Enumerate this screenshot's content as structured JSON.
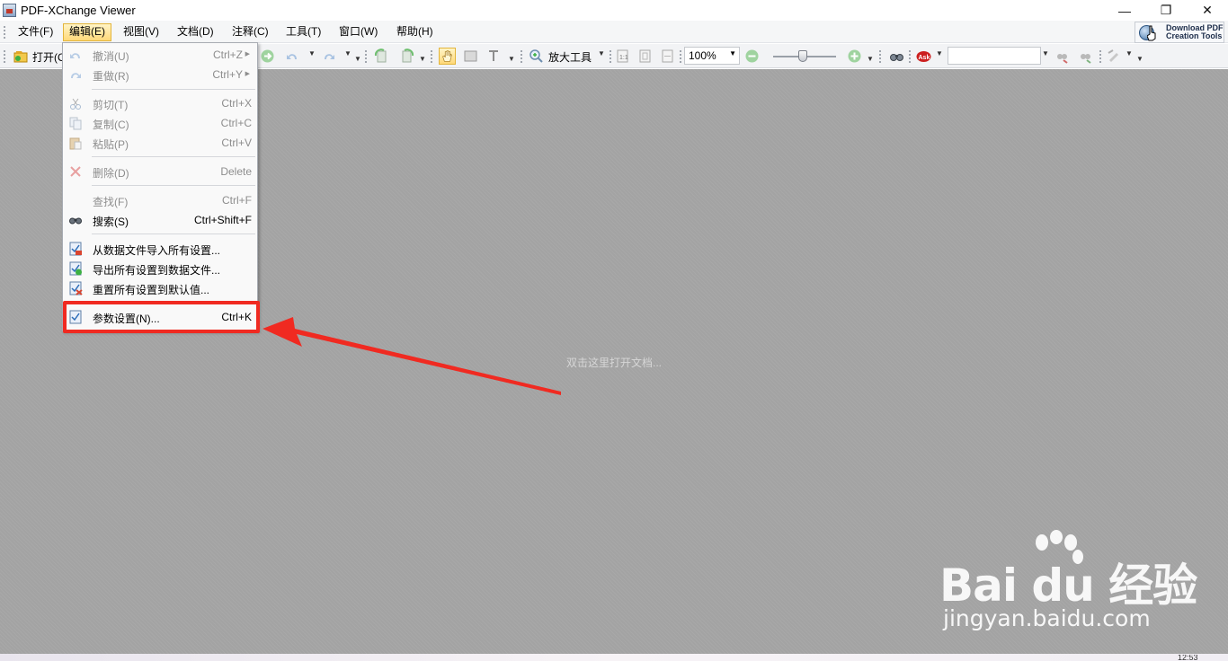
{
  "window": {
    "title": "PDF-XChange Viewer",
    "controls": {
      "minimize": "—",
      "maximize": "❐",
      "close": "✕"
    }
  },
  "menubar": {
    "items": [
      {
        "label": "文件(F)"
      },
      {
        "label": "编辑(E)"
      },
      {
        "label": "视图(V)"
      },
      {
        "label": "文档(D)"
      },
      {
        "label": "注释(C)"
      },
      {
        "label": "工具(T)"
      },
      {
        "label": "窗口(W)"
      },
      {
        "label": "帮助(H)"
      }
    ],
    "active_index": 1
  },
  "download_button": {
    "label": "Download PDF\nCreation Tools"
  },
  "toolbar": {
    "open_label": "打开(O)",
    "zoom_tool_label": "放大工具",
    "zoom_value": "100%",
    "search_value": ""
  },
  "edit_menu": {
    "items": [
      {
        "label": "撤消(U)",
        "shortcut": "Ctrl+Z",
        "enabled": false,
        "icon": "undo-icon",
        "submenu": true
      },
      {
        "label": "重做(R)",
        "shortcut": "Ctrl+Y",
        "enabled": false,
        "icon": "redo-icon",
        "submenu": true
      },
      {
        "label": "剪切(T)",
        "shortcut": "Ctrl+X",
        "enabled": false,
        "icon": "scissors-icon"
      },
      {
        "label": "复制(C)",
        "shortcut": "Ctrl+C",
        "enabled": false,
        "icon": "copy-icon"
      },
      {
        "label": "粘贴(P)",
        "shortcut": "Ctrl+V",
        "enabled": false,
        "icon": "paste-icon"
      },
      {
        "label": "删除(D)",
        "shortcut": "Delete",
        "enabled": false,
        "icon": "delete-icon"
      },
      {
        "label": "查找(F)",
        "shortcut": "Ctrl+F",
        "enabled": false,
        "icon": ""
      },
      {
        "label": "搜索(S)",
        "shortcut": "Ctrl+Shift+F",
        "enabled": true,
        "icon": "binoculars-icon"
      },
      {
        "label": "从数据文件导入所有设置...",
        "shortcut": "",
        "enabled": true,
        "icon": "import-settings-icon"
      },
      {
        "label": "导出所有设置到数据文件...",
        "shortcut": "",
        "enabled": true,
        "icon": "export-settings-icon"
      },
      {
        "label": "重置所有设置到默认值...",
        "shortcut": "",
        "enabled": true,
        "icon": "reset-settings-icon"
      },
      {
        "label": "参数设置(N)...",
        "shortcut": "Ctrl+K",
        "enabled": true,
        "icon": "preferences-icon"
      }
    ]
  },
  "document_area": {
    "hint": "双击这里打开文档..."
  },
  "watermark": {
    "main": "Bai du 经验",
    "sub": "jingyan.baidu.com"
  },
  "statusbar": {
    "time": "12:53"
  },
  "colors": {
    "annotation_red": "#f02a21",
    "menu_active": "#ffd97a",
    "canvas": "#a3a3a3"
  }
}
